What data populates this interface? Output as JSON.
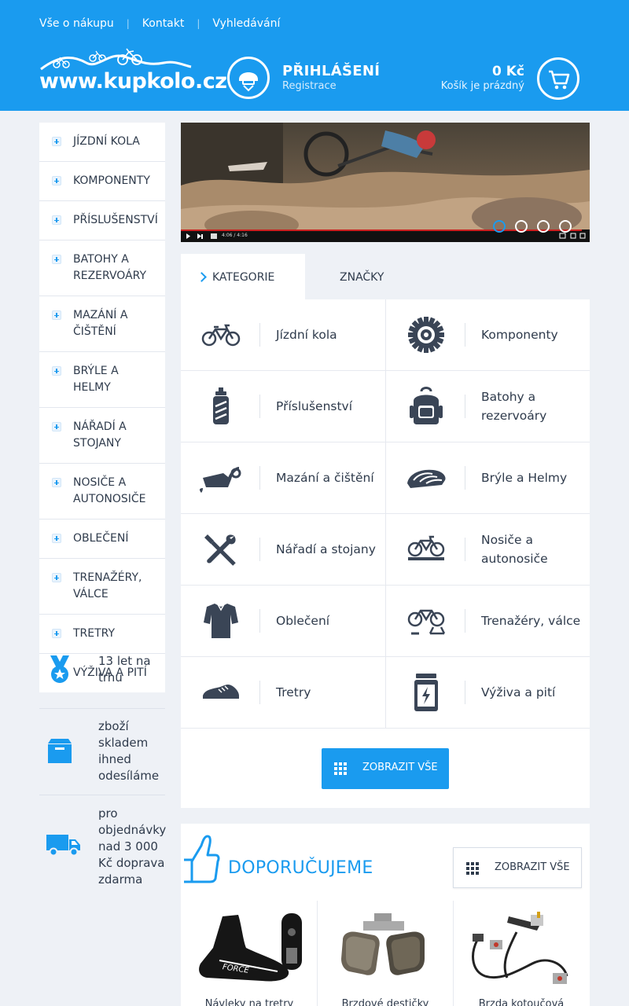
{
  "topnav": [
    "Vše o nákupu",
    "Kontakt",
    "Vyhledávání"
  ],
  "logo": {
    "text": "www.kupkolo.cz"
  },
  "login": {
    "title": "PŘIHLÁŠENÍ",
    "register": "Registrace"
  },
  "cart": {
    "price": "0 Kč",
    "status": "Košík je prázdný"
  },
  "sidebar": [
    "JÍZDNÍ KOLA",
    "KOMPONENTY",
    "PŘÍSLUŠENSTVÍ",
    "BATOHY A REZERVOÁRY",
    "MAZÁNÍ A ČIŠTĚNÍ",
    "BRÝLE A HELMY",
    "NÁŘADÍ A STOJANY",
    "NOSIČE A AUTONOSIČE",
    "OBLEČENÍ",
    "TRENAŽÉRY, VÁLCE",
    "TRETRY",
    "VÝŽIVA A PITÍ"
  ],
  "benefits": [
    {
      "icon": "medal-icon",
      "text": "13 let na trhu"
    },
    {
      "icon": "box-icon",
      "text": "zboží skladem ihned odesíláme"
    },
    {
      "icon": "truck-icon",
      "text": "pro objednávky nad 3 000 Kč doprava zdarma"
    }
  ],
  "video": {
    "time": "4:06 / 4:16",
    "progress": 0.98
  },
  "slider": {
    "count": 4,
    "active": 0
  },
  "tabs": {
    "active": "KATEGORIE",
    "inactive": "ZNAČKY"
  },
  "categories": [
    {
      "name": "Jízdní kola",
      "icon": "bicycle-icon"
    },
    {
      "name": "Komponenty",
      "icon": "gear-icon"
    },
    {
      "name": "Příslušenství",
      "icon": "bottle-icon"
    },
    {
      "name": "Batohy a rezervoáry",
      "icon": "backpack-icon"
    },
    {
      "name": "Mazání a čištění",
      "icon": "oil-can-icon"
    },
    {
      "name": "Brýle a Helmy",
      "icon": "helmet-icon"
    },
    {
      "name": "Nářadí a stojany",
      "icon": "tools-icon"
    },
    {
      "name": "Nosiče a autonosiče",
      "icon": "bike-rack-icon"
    },
    {
      "name": "Oblečení",
      "icon": "jersey-icon"
    },
    {
      "name": "Trenažéry, válce",
      "icon": "trainer-icon"
    },
    {
      "name": "Tretry",
      "icon": "shoe-icon"
    },
    {
      "name": "Výživa a pití",
      "icon": "nutrition-jar-icon"
    }
  ],
  "show_all": "ZOBRAZIT VŠE",
  "recommended": {
    "title": "DOPORUČUJEME",
    "button": "ZOBRAZIT VŠE",
    "products": [
      {
        "name": "Návleky na tretry",
        "icon": "shoe-cover-icon"
      },
      {
        "name": "Brzdové destičky",
        "icon": "brake-pads-icon"
      },
      {
        "name": "Brzda kotoučová",
        "icon": "disc-brake-icon"
      }
    ]
  },
  "colors": {
    "primary": "#1a9bef",
    "dark": "#2f3b4c",
    "background": "#eef1f6"
  }
}
